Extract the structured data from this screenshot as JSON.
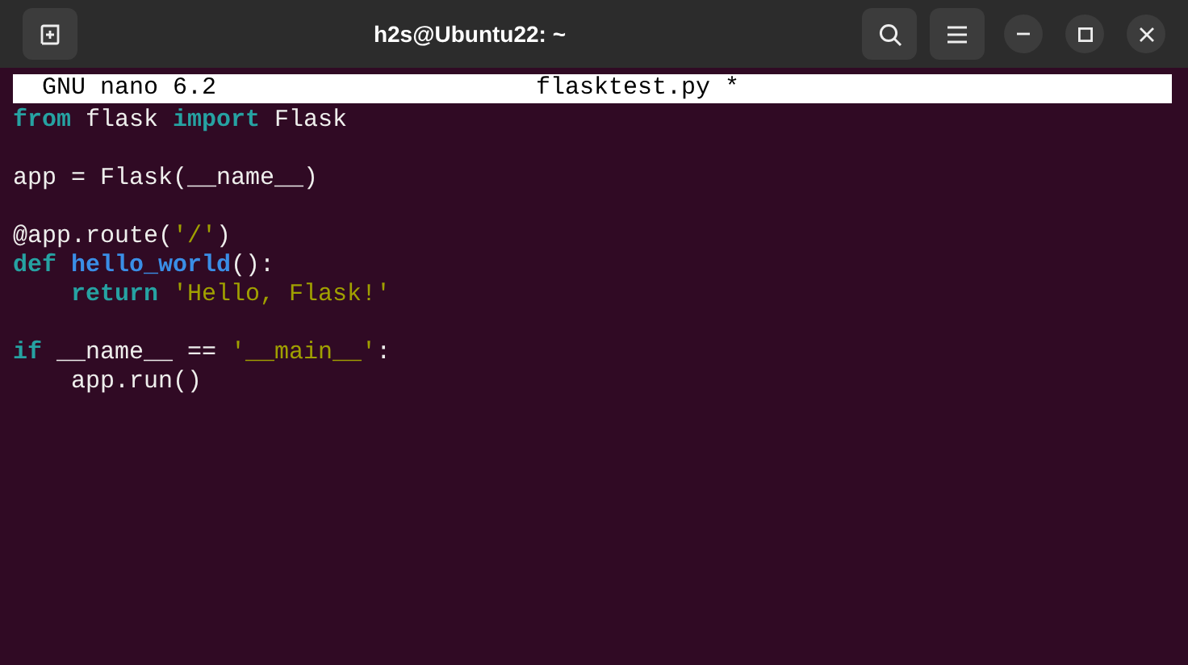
{
  "window": {
    "title": "h2s@Ubuntu22: ~"
  },
  "nano_header": {
    "version": "GNU nano 6.2",
    "filename": "flasktest.py *"
  },
  "lines": [
    {
      "kind": "code",
      "indented": false,
      "tokens": [
        {
          "text": "from",
          "kind": "keyword"
        },
        {
          "text": " flask ",
          "kind": "plain"
        },
        {
          "text": "import",
          "kind": "keyword"
        },
        {
          "text": " Flask",
          "kind": "plain"
        }
      ]
    },
    {
      "kind": "blank"
    },
    {
      "kind": "code",
      "indented": false,
      "tokens": [
        {
          "text": "app = Flask(__name__)",
          "kind": "plain"
        }
      ]
    },
    {
      "kind": "blank"
    },
    {
      "kind": "code",
      "indented": false,
      "tokens": [
        {
          "text": "@app.route(",
          "kind": "plain"
        },
        {
          "text": "'/'",
          "kind": "string"
        },
        {
          "text": ")",
          "kind": "plain"
        }
      ]
    },
    {
      "kind": "code",
      "indented": false,
      "tokens": [
        {
          "text": "def ",
          "kind": "keyword"
        },
        {
          "text": "hello_world",
          "kind": "function"
        },
        {
          "text": "():",
          "kind": "plain"
        }
      ]
    },
    {
      "kind": "code",
      "indented": true,
      "tokens": [
        {
          "text": "return ",
          "kind": "keyword"
        },
        {
          "text": "'Hello, Flask!'",
          "kind": "string"
        }
      ]
    },
    {
      "kind": "blank"
    },
    {
      "kind": "code",
      "indented": false,
      "tokens": [
        {
          "text": "if",
          "kind": "keyword"
        },
        {
          "text": " __name__ == ",
          "kind": "plain"
        },
        {
          "text": "'__main__'",
          "kind": "string"
        },
        {
          "text": ":",
          "kind": "plain"
        }
      ]
    },
    {
      "kind": "code",
      "indented": true,
      "tokens": [
        {
          "text": "app.run()",
          "kind": "plain"
        }
      ]
    }
  ]
}
